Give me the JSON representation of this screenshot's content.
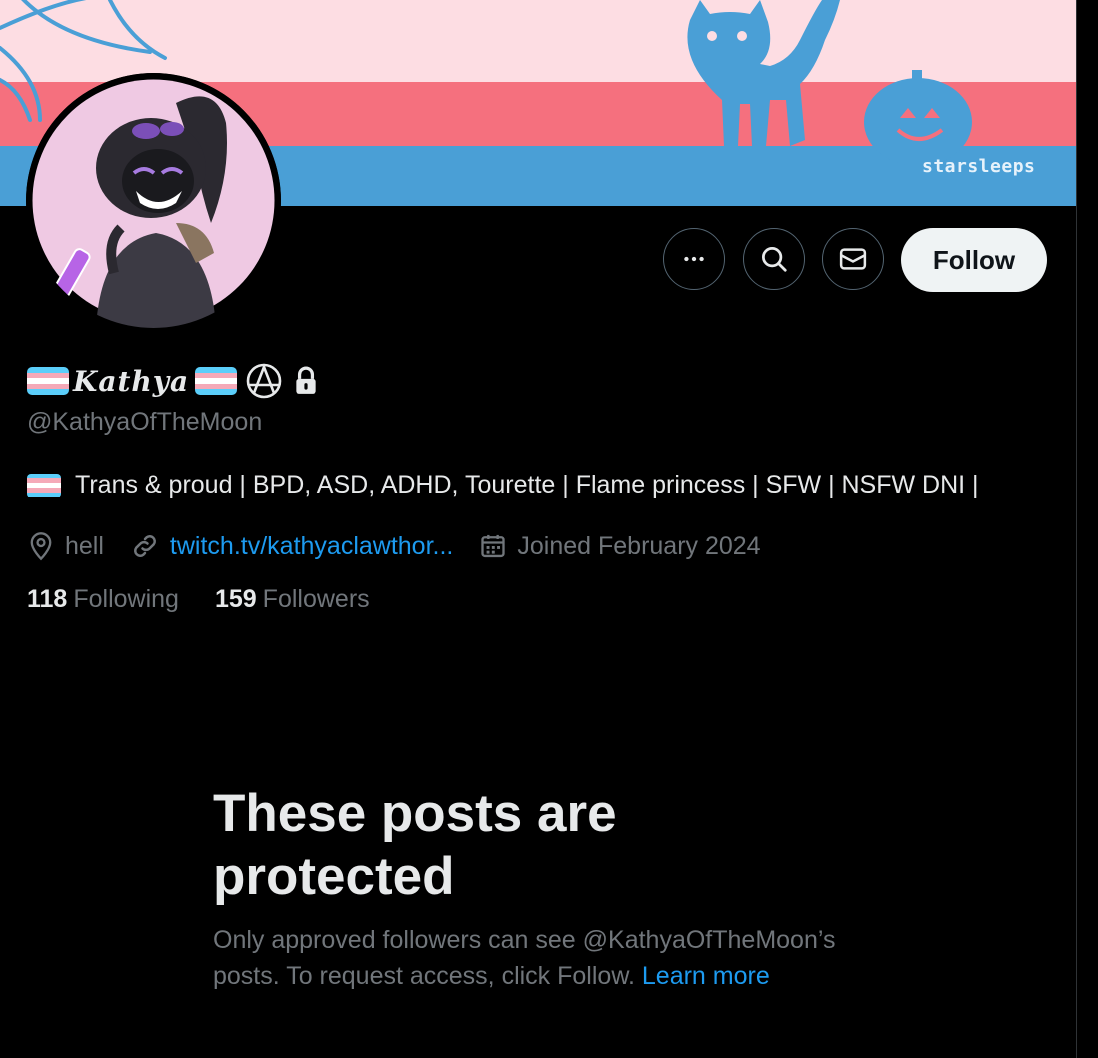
{
  "banner": {
    "credit": "starsleeps",
    "colors": {
      "pink_light": "#fddde3",
      "pink": "#f5707e",
      "blue": "#4a9fd6"
    }
  },
  "profile": {
    "display_name": "Kathya",
    "handle": "@KathyaOfTheMoon",
    "protected": true,
    "bio": "Trans & proud | BPD, ASD, ADHD, Tourette | Flame princess  | SFW | NSFW DNI |",
    "location": "hell",
    "website": "twitch.tv/kathyaclawthor...",
    "joined": "Joined February 2024",
    "following_count": "118",
    "following_label": "Following",
    "followers_count": "159",
    "followers_label": "Followers"
  },
  "actions": {
    "more_icon": "more-icon",
    "search_icon": "search-icon",
    "message_icon": "mail-icon",
    "follow_label": "Follow"
  },
  "protected_notice": {
    "title": "These posts are protected",
    "desc_prefix": "Only approved followers can see @KathyaOfTheMoon’s posts. To request access, click Follow.",
    "learn_more": "Learn more"
  },
  "colors": {
    "background": "#000000",
    "text_primary": "#e7e9ea",
    "text_secondary": "#71767b",
    "accent": "#1d9bf0",
    "flag_blue": "#5bcefa",
    "flag_pink": "#f5a9b8",
    "flag_white": "#ffffff"
  }
}
